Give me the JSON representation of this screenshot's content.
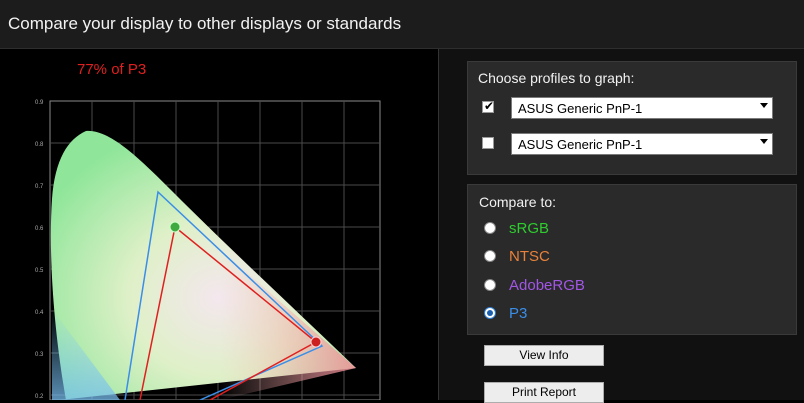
{
  "window": {
    "title": "Compare your display to other displays or standards"
  },
  "graph": {
    "coverage_text": "77% of P3",
    "y_ticks": [
      "0.9",
      "0.8",
      "0.7",
      "0.6",
      "0.5",
      "0.4",
      "0.3",
      "0.2"
    ],
    "display_color": "#e02020",
    "standard_color": "#3a8ee8"
  },
  "profiles": {
    "title": "Choose profiles to graph:",
    "items": [
      {
        "checked": true,
        "check_glyph": "✔",
        "value": "ASUS Generic PnP-1"
      },
      {
        "checked": false,
        "check_glyph": "",
        "value": "ASUS Generic PnP-1"
      }
    ]
  },
  "compare": {
    "title": "Compare to:",
    "options": [
      {
        "label": "sRGB",
        "color": "#2ecc2e",
        "selected": false
      },
      {
        "label": "NTSC",
        "color": "#e8823a",
        "selected": false
      },
      {
        "label": "AdobeRGB",
        "color": "#a256e6",
        "selected": false
      },
      {
        "label": "P3",
        "color": "#3a8ee8",
        "selected": true
      }
    ]
  },
  "buttons": {
    "view_info": "View Info",
    "print_report": "Print Report"
  }
}
